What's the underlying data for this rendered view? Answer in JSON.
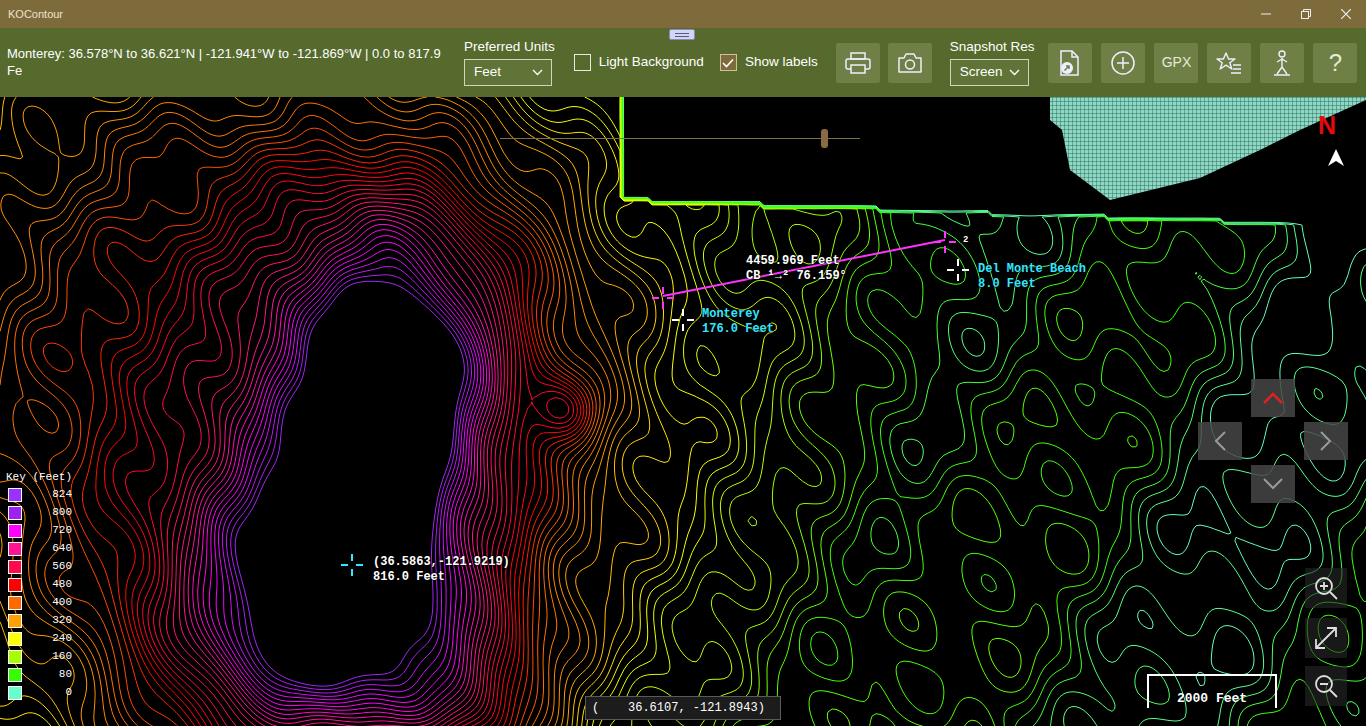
{
  "window": {
    "title": "KOContour"
  },
  "toolbar": {
    "region": "Monterey:  36.578°N to 36.621°N | -121.941°W to -121.869°W | 0.0 to 817.9 Fe",
    "units": {
      "label": "Preferred Units",
      "value": "Feet"
    },
    "checkboxes": [
      {
        "label": "Light Background",
        "checked": false
      },
      {
        "label": "Show labels",
        "checked": true
      }
    ],
    "snapshot": {
      "label": "Snapshot Res",
      "value": "Screen"
    },
    "text_buttons": [
      "GPX",
      "?"
    ]
  },
  "map": {
    "opacity_slider": {
      "level": 0.9
    },
    "north": "N",
    "legend": {
      "title": "Key (Feet)",
      "entries": [
        {
          "label": "824",
          "color": "#9a32ff"
        },
        {
          "label": "800",
          "color": "#a020f0"
        },
        {
          "label": "720",
          "color": "#ff00ff"
        },
        {
          "label": "640",
          "color": "#ff1493"
        },
        {
          "label": "560",
          "color": "#ff0a4a"
        },
        {
          "label": "480",
          "color": "#ff0000"
        },
        {
          "label": "400",
          "color": "#ff6a00"
        },
        {
          "label": "320",
          "color": "#ff9f00"
        },
        {
          "label": "240",
          "color": "#ffff00"
        },
        {
          "label": "160",
          "color": "#a8ff00"
        },
        {
          "label": "80",
          "color": "#33ff00"
        },
        {
          "label": "0",
          "color": "#66ffcc"
        }
      ]
    },
    "peak": {
      "coords": "(36.5863,-121.9219)",
      "elevation": "816.0 Feet"
    },
    "places": [
      {
        "name": "Monterey",
        "elevation": "176.0 Feet"
      },
      {
        "name": "Del Monte Beach",
        "elevation": "8.0 Feet"
      }
    ],
    "measurement": {
      "distance": "4459.969 Feet",
      "bearing": "CB ¹→² 76.159°",
      "end_label": "2"
    },
    "scale": "2000 Feet",
    "cursor": "(    36.6107, -121.8943)"
  }
}
